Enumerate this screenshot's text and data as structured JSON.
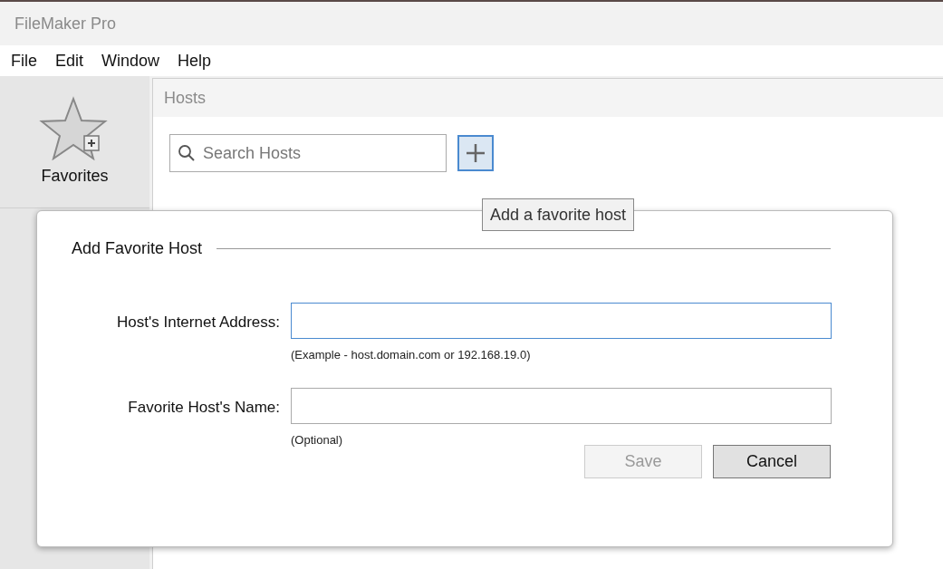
{
  "window": {
    "title": "FileMaker Pro"
  },
  "menu": [
    "File",
    "Edit",
    "Window",
    "Help"
  ],
  "sidebar": {
    "items": [
      {
        "label": "Favorites",
        "selected": false
      }
    ]
  },
  "hosts_panel": {
    "title": "Hosts",
    "search": {
      "placeholder": "Search Hosts"
    },
    "tooltip": "Add a favorite host"
  },
  "dialog": {
    "title": "Add Favorite Host",
    "fields": [
      {
        "label": "Host's Internet Address:",
        "hint": "(Example - host.domain.com or 192.168.19.0)",
        "focused": true
      },
      {
        "label": "Favorite Host's Name:",
        "hint": "(Optional)",
        "focused": false
      }
    ],
    "buttons": [
      {
        "label": "Save",
        "disabled": true
      },
      {
        "label": "Cancel",
        "disabled": false
      }
    ]
  }
}
